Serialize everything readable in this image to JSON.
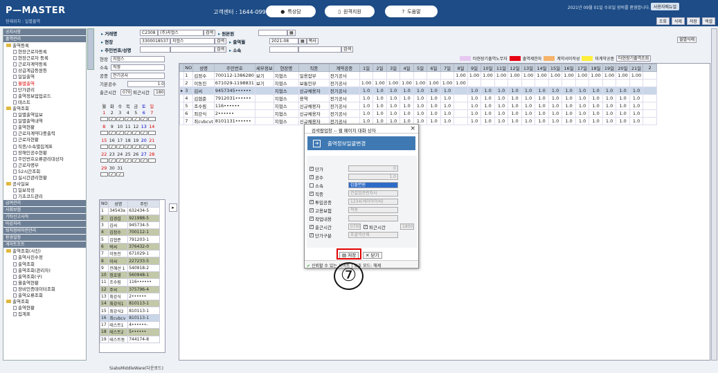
{
  "header": {
    "logo": "P—MASTER",
    "breadcrumb": "현재위치 : 일별출역",
    "center_label": "고객센터 : 1644-0997",
    "btn_chat": "특상담",
    "btn_remote": "원격지원",
    "btn_help": "도움말",
    "info": "2021년 09월 01일 수요일  장비를 환영합니다.",
    "logout": "사용자메뉴얼",
    "link_query": "조회",
    "link_delete": "삭제",
    "link_save": "저장",
    "link_excel": "엑셀"
  },
  "menu": {
    "items": [
      {
        "t": "c",
        "l": "공지사항"
      },
      {
        "t": "c",
        "l": "출역관리"
      },
      {
        "t": "f",
        "l": "출역등록"
      },
      {
        "t": "i",
        "l": "현장근로자등록"
      },
      {
        "t": "i",
        "l": "현장근로자 등록"
      },
      {
        "t": "i",
        "l": "근로자계약등록"
      },
      {
        "t": "i",
        "l": "상급계급등원등"
      },
      {
        "t": "i",
        "l": "일일출역"
      },
      {
        "t": "i",
        "l": "월별출역",
        "red": true
      },
      {
        "t": "i",
        "l": "단가관리"
      },
      {
        "t": "i",
        "l": "출역정보업업로드"
      },
      {
        "t": "i",
        "l": "테스트"
      },
      {
        "t": "f",
        "l": "출역조회"
      },
      {
        "t": "i",
        "l": "일별출역일보"
      },
      {
        "t": "i",
        "l": "일별출역내역"
      },
      {
        "t": "i",
        "l": "출역현황"
      },
      {
        "t": "i",
        "l": "근로자계약다중출력"
      },
      {
        "t": "i",
        "l": "근로자현황"
      },
      {
        "t": "i",
        "l": "직종/소속별집계표"
      },
      {
        "t": "i",
        "l": "장해인공수현황"
      },
      {
        "t": "i",
        "l": "주민번호오류관리대상자"
      },
      {
        "t": "i",
        "l": "근로자명부"
      },
      {
        "t": "i",
        "l": "52시간조회"
      },
      {
        "t": "i",
        "l": "실시간관리현황"
      },
      {
        "t": "f",
        "l": "공사일보"
      },
      {
        "t": "i",
        "l": "일보작성"
      },
      {
        "t": "i",
        "l": "기초코드관리"
      },
      {
        "t": "c",
        "l": "급여관리"
      },
      {
        "t": "c",
        "l": "사회보험"
      },
      {
        "t": "c",
        "l": "기타신고사직"
      },
      {
        "t": "c",
        "l": "마감처리"
      },
      {
        "t": "c",
        "l": "퇴직정비마련관리"
      },
      {
        "t": "c",
        "l": "환경설정"
      },
      {
        "t": "c",
        "l": "게이트조트"
      },
      {
        "t": "f",
        "l": "출역조회(사진)"
      },
      {
        "t": "i",
        "l": "출역사진수정"
      },
      {
        "t": "i",
        "l": "출역조회"
      },
      {
        "t": "i",
        "l": "출역조회(관리자)"
      },
      {
        "t": "i",
        "l": "출역조회(구)"
      },
      {
        "t": "i",
        "l": "월출역현황"
      },
      {
        "t": "i",
        "l": "장비인증데이터조회"
      },
      {
        "t": "i",
        "l": "출역오류조회"
      },
      {
        "t": "f",
        "l": "출역조회"
      },
      {
        "t": "i",
        "l": "출역현황"
      },
      {
        "t": "i",
        "l": "집계표"
      }
    ]
  },
  "form": {
    "company_label": "거래명",
    "company_code": "C2308",
    "company_name": "(주)지협스",
    "search": "검색",
    "site_label": "현장",
    "site_code": "3300018537",
    "site_name": "지협스",
    "regno_label": "주민번호/성명",
    "manager_label": "원본원",
    "month_label": "출역월",
    "month_value": "2021-08",
    "copy_btn": "복사",
    "belong_label": "소속",
    "monthly_delete": "월별삭제",
    "daily_query": "타현장기출역조회"
  },
  "legend": {
    "items": [
      {
        "label": "타현장기출역노무자",
        "color": "#e6c8f0"
      },
      {
        "label": "출역제한자",
        "color": "#e60012"
      },
      {
        "label": "계약서미작성",
        "color": "#f6b36a"
      },
      {
        "label": "미계약공종",
        "color": "#ffef3a"
      }
    ]
  },
  "left_panel": {
    "site_label": "현장",
    "site_value": "지협스",
    "belong_label": "소속",
    "belong_value": "직영",
    "trade_label": "공종",
    "trade_value": "전기공사",
    "base_label": "기본공수",
    "base_value": "1.0",
    "in_label": "출근시간",
    "in_value": "0700",
    "out_label": "퇴근시간",
    "out_value": "1800",
    "days": [
      "월",
      "화",
      "수",
      "목",
      "금",
      "토",
      "일"
    ],
    "weeks": [
      [
        "1",
        "2",
        "3",
        "4",
        "5",
        "6",
        "7"
      ],
      [
        "8",
        "9",
        "10",
        "11",
        "12",
        "13",
        "14"
      ],
      [
        "15",
        "16",
        "17",
        "18",
        "19",
        "20",
        "21"
      ],
      [
        "22",
        "23",
        "24",
        "25",
        "26",
        "27",
        "28"
      ],
      [
        "29",
        "30",
        "31",
        "",
        "",
        "",
        ""
      ]
    ]
  },
  "people": {
    "headers": [
      "NO",
      "성명",
      "주민"
    ],
    "rows": [
      [
        "1",
        "34543a",
        "632434-5"
      ],
      [
        "2",
        "김경섭",
        "921988-5"
      ],
      [
        "3",
        "김씨",
        "945734-5"
      ],
      [
        "4",
        "김정수",
        "700112-1"
      ],
      [
        "5",
        "김협준",
        "791203-1"
      ],
      [
        "6",
        "박씨",
        "376432-0"
      ],
      [
        "7",
        "이동진",
        "671029-1"
      ],
      [
        "8",
        "이씨",
        "227233-5"
      ],
      [
        "9",
        "전혜선 1",
        "540918-2"
      ],
      [
        "10",
        "정호영",
        "560948-1"
      ],
      [
        "11",
        "조수림",
        "116••••••"
      ],
      [
        "12",
        "주씨",
        "375796-4"
      ],
      [
        "13",
        "최강식",
        "2••••••"
      ],
      [
        "14",
        "최강식1",
        "810113-1"
      ],
      [
        "15",
        "최강식2",
        "810113-1"
      ],
      [
        "16",
        "최cvbcv",
        "810113-1"
      ],
      [
        "17",
        "테스트1",
        "4••••••-"
      ],
      [
        "18",
        "테스트2",
        "5••••••"
      ],
      [
        "19",
        "테스트동",
        "744174-8"
      ]
    ]
  },
  "grid": {
    "headers": [
      "NO",
      "성명",
      "주민번호",
      "세부정보",
      "현장명",
      "직종",
      "계약공종",
      "1일",
      "2일",
      "3일",
      "4일",
      "5일",
      "6일",
      "7일",
      "8일",
      "9일",
      "10일",
      "11일",
      "12일",
      "13일",
      "14일",
      "15일",
      "16일",
      "17일",
      "18일",
      "19일",
      "20일",
      "21일",
      "2"
    ],
    "rows": [
      [
        "1",
        "김정수",
        "700112-1386280",
        "보기",
        "지협스",
        "일용잡부",
        "전기공사",
        "",
        "",
        "",
        "",
        "",
        "",
        "",
        "1.00",
        "1.00",
        "1.00",
        "1.00",
        "1.00",
        "1.00",
        "1.00",
        "1.00",
        "1.00",
        "1.00",
        "1.00",
        "1.00",
        "1.00",
        "1.00",
        ""
      ],
      [
        "2",
        "이동진",
        "671029-1198831",
        "보기",
        "지협스",
        "보통인부",
        "전기공사",
        "1.00",
        "1.00",
        "1.00",
        "1.00",
        "1.00",
        "1.00",
        "1.00",
        "1.00",
        "",
        "",
        "",
        "",
        "",
        "",
        "",
        "",
        "",
        "",
        "",
        "",
        "",
        ""
      ],
      [
        "3",
        "김씨",
        "9457345••••••",
        "",
        "지협스",
        "신규채용자",
        "전기공사",
        "1.0",
        "1.0",
        "1.0",
        "1.0",
        "1.0",
        "1.0",
        "1.0",
        "",
        "1.0",
        "1.0",
        "1.0",
        "1.0",
        "1.0",
        "1.0",
        "1.0",
        "1.0",
        "1.0",
        "1.0",
        "1.0",
        "1.0",
        "1.0",
        ""
      ],
      [
        "4",
        "김협준",
        "7912031••••••",
        "",
        "지협스",
        "용역",
        "전기공사",
        "1.0",
        "1.0",
        "1.0",
        "1.0",
        "1.0",
        "1.0",
        "1.0",
        "",
        "1.0",
        "1.0",
        "1.0",
        "1.0",
        "1.0",
        "1.0",
        "1.0",
        "1.0",
        "1.0",
        "1.0",
        "1.0",
        "1.0",
        "1.0",
        ""
      ],
      [
        "5",
        "조수림",
        "116••••••",
        "",
        "지협스",
        "신규채용자",
        "전기공사",
        "1.0",
        "1.0",
        "1.0",
        "1.0",
        "1.0",
        "1.0",
        "1.0",
        "",
        "1.0",
        "1.0",
        "1.0",
        "1.0",
        "1.0",
        "1.0",
        "1.0",
        "1.0",
        "1.0",
        "1.0",
        "1.0",
        "1.0",
        "1.0",
        ""
      ],
      [
        "6",
        "최강식",
        "2••••••",
        "",
        "지협스",
        "신규채용자",
        "전기공사",
        "1.0",
        "1.0",
        "1.0",
        "1.0",
        "1.0",
        "1.0",
        "1.0",
        "",
        "1.0",
        "1.0",
        "1.0",
        "1.0",
        "1.0",
        "1.0",
        "1.0",
        "1.0",
        "1.0",
        "1.0",
        "1.0",
        "1.0",
        "1.0",
        ""
      ],
      [
        "7",
        "최cvbcvt",
        "8101131••••••",
        "",
        "지협스",
        "신규채용자",
        "전기공사",
        "1.0",
        "1.0",
        "1.0",
        "1.0",
        "1.0",
        "1.0",
        "1.0",
        "",
        "1.0",
        "1.0",
        "1.0",
        "1.0",
        "1.0",
        "1.0",
        "1.0",
        "1.0",
        "1.0",
        "1.0",
        "1.0",
        "1.0",
        "1.0",
        ""
      ]
    ]
  },
  "dialog": {
    "title": "검색팝업창 -- 웹 페이지 대화 상자",
    "banner": "출역정보일괄변경",
    "f_price": "단가",
    "price_val": "0",
    "f_gongsu": "공수",
    "gongsu_val": "1.0",
    "f_belong": "소속",
    "belong_val": "갑출변원",
    "f_trade": "직종",
    "trade_val": "건설업관련자사",
    "f_input": "투입공종",
    "input_val": "1234(세이아이씨)",
    "f_ins": "고용보험",
    "ins_val": "적용",
    "f_work": "작업내용",
    "f_in": "출근시간",
    "in_val": "0700",
    "f_out": "퇴근시간",
    "out_val": "1800",
    "f_ptype": "단가구분",
    "ptype_val": "포괄역산제",
    "save": "저장",
    "close": "닫기",
    "status": "신뢰할 수 있는 사이트 | 보호 모드: 해제"
  },
  "annotation": {
    "marker": "⑦"
  },
  "bottom": {
    "status": "SiabsMiddleWare(다운로드)"
  }
}
